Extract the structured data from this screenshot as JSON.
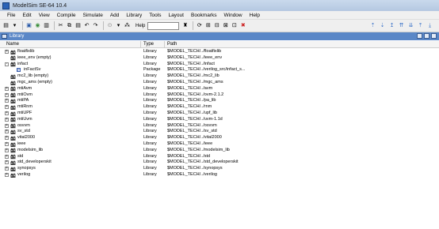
{
  "window": {
    "title": "ModelSim SE-64 10.4"
  },
  "menu": [
    "File",
    "Edit",
    "View",
    "Compile",
    "Simulate",
    "Add",
    "Library",
    "Tools",
    "Layout",
    "Bookmarks",
    "Window",
    "Help"
  ],
  "toolbar": {
    "help_label": "Help",
    "help_value": "",
    "left_icons": [
      "new-file-icon",
      "open-icon",
      "save-icon",
      "print-icon",
      "cut-icon",
      "copy-icon",
      "paste-icon",
      "undo-icon",
      "redo-icon",
      "compile-icon",
      "find-icon"
    ],
    "right_icons": [
      "step-icon",
      "step-over-icon",
      "restart-icon",
      "break-icon",
      "run-icon",
      "stop-icon",
      "zoom-icon",
      "clear-icon"
    ],
    "far_right_icons": [
      "up-arrow-icon",
      "down-arrow-icon",
      "up-arrow-icon",
      "up-all-icon",
      "down-all-icon",
      "expand-icon",
      "collapse-icon"
    ]
  },
  "panel": {
    "title": "Library"
  },
  "columns": {
    "name": "Name",
    "type": "Type",
    "path": "Path"
  },
  "rows": [
    {
      "name": "floatfixlib",
      "type": "Library",
      "path": "$MODEL_TECH/../floatfixlib",
      "kind": "lib",
      "expander": "+",
      "indent": 0
    },
    {
      "name": "ieee_env (empty)",
      "type": "Library",
      "path": "$MODEL_TECH/../ieee_env",
      "kind": "lib",
      "expander": "",
      "indent": 0
    },
    {
      "name": "infact",
      "type": "Library",
      "path": "$MODEL_TECH/../infact",
      "kind": "lib",
      "expander": "-",
      "indent": 0
    },
    {
      "name": "inFactSv",
      "type": "Package",
      "path": "$MODEL_TECH/../verilog_src/infact_s...",
      "kind": "pkg",
      "expander": "",
      "indent": 1
    },
    {
      "name": "mc2_lib (empty)",
      "type": "Library",
      "path": "$MODEL_TECH/../mc2_lib",
      "kind": "lib",
      "expander": "",
      "indent": 0
    },
    {
      "name": "mgc_ams (empty)",
      "type": "Library",
      "path": "$MODEL_TECH/../mgc_ams",
      "kind": "lib",
      "expander": "",
      "indent": 0
    },
    {
      "name": "mtiAvm",
      "type": "Library",
      "path": "$MODEL_TECH/../avm",
      "kind": "lib",
      "expander": "+",
      "indent": 0
    },
    {
      "name": "mtiOvm",
      "type": "Library",
      "path": "$MODEL_TECH/../ovm-2.1.2",
      "kind": "lib",
      "expander": "+",
      "indent": 0
    },
    {
      "name": "mtiPA",
      "type": "Library",
      "path": "$MODEL_TECH/../pa_lib",
      "kind": "lib",
      "expander": "+",
      "indent": 0
    },
    {
      "name": "mtiRnm",
      "type": "Library",
      "path": "$MODEL_TECH/../rnm",
      "kind": "lib",
      "expander": "+",
      "indent": 0
    },
    {
      "name": "mtiUPF",
      "type": "Library",
      "path": "$MODEL_TECH/../upf_lib",
      "kind": "lib",
      "expander": "+",
      "indent": 0
    },
    {
      "name": "mtiUvm",
      "type": "Library",
      "path": "$MODEL_TECH/../uvm-1.1d",
      "kind": "lib",
      "expander": "+",
      "indent": 0
    },
    {
      "name": "osvvm",
      "type": "Library",
      "path": "$MODEL_TECH/../osvvm",
      "kind": "lib",
      "expander": "+",
      "indent": 0
    },
    {
      "name": "sv_std",
      "type": "Library",
      "path": "$MODEL_TECH/../sv_std",
      "kind": "lib",
      "expander": "+",
      "indent": 0
    },
    {
      "name": "vital2000",
      "type": "Library",
      "path": "$MODEL_TECH/../vital2000",
      "kind": "lib",
      "expander": "+",
      "indent": 0
    },
    {
      "name": "ieee",
      "type": "Library",
      "path": "$MODEL_TECH/../ieee",
      "kind": "lib",
      "expander": "+",
      "indent": 0
    },
    {
      "name": "modelsim_lib",
      "type": "Library",
      "path": "$MODEL_TECH/../modelsim_lib",
      "kind": "lib",
      "expander": "+",
      "indent": 0
    },
    {
      "name": "std",
      "type": "Library",
      "path": "$MODEL_TECH/../std",
      "kind": "lib",
      "expander": "+",
      "indent": 0
    },
    {
      "name": "std_developerskit",
      "type": "Library",
      "path": "$MODEL_TECH/../std_developerskit",
      "kind": "lib",
      "expander": "+",
      "indent": 0
    },
    {
      "name": "synopsys",
      "type": "Library",
      "path": "$MODEL_TECH/../synopsys",
      "kind": "lib",
      "expander": "+",
      "indent": 0
    },
    {
      "name": "verilog",
      "type": "Library",
      "path": "$MODEL_TECH/../verilog",
      "kind": "lib",
      "expander": "+",
      "indent": 0
    }
  ],
  "colors": {
    "panel_header": "#5a87c7",
    "title_bar": "#c9d9ec",
    "library_icon": "#2f2f2f"
  }
}
